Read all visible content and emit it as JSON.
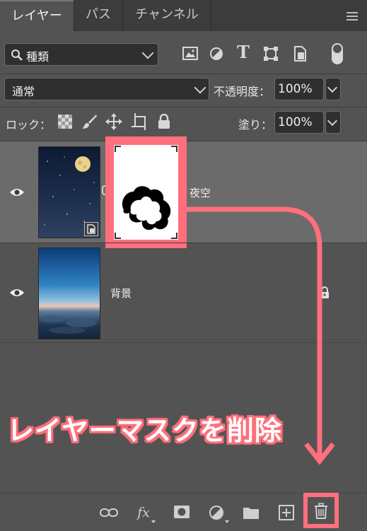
{
  "tabs": [
    {
      "label": "レイヤー",
      "active": true
    },
    {
      "label": "パス",
      "active": false
    },
    {
      "label": "チャンネル",
      "active": false
    }
  ],
  "filter": {
    "kind_label": "種類"
  },
  "blend": {
    "mode": "通常",
    "opacity_label": "不透明度：",
    "opacity_value": "100%"
  },
  "lock": {
    "label": "ロック：",
    "fill_label": "塗り：",
    "fill_value": "100%"
  },
  "layers": [
    {
      "name": "夜空",
      "selected": true,
      "visible": true,
      "has_mask": true,
      "smart_object": true
    },
    {
      "name": "背景",
      "selected": false,
      "visible": true,
      "locked": true
    }
  ],
  "bottom_icons": [
    "link-icon",
    "fx-icon",
    "mask-icon",
    "adjustment-icon",
    "folder-icon",
    "new-layer-icon",
    "trash-icon"
  ],
  "bottom_text": {
    "fx": "fx"
  },
  "annotation": {
    "text": "レイヤーマスクを削除",
    "color": "#ff6f7c"
  },
  "colors": {
    "panel": "#535353",
    "tabbar": "#3c3c3c",
    "selected_row": "#6b6b6b",
    "highlight": "#ff6f7c"
  }
}
